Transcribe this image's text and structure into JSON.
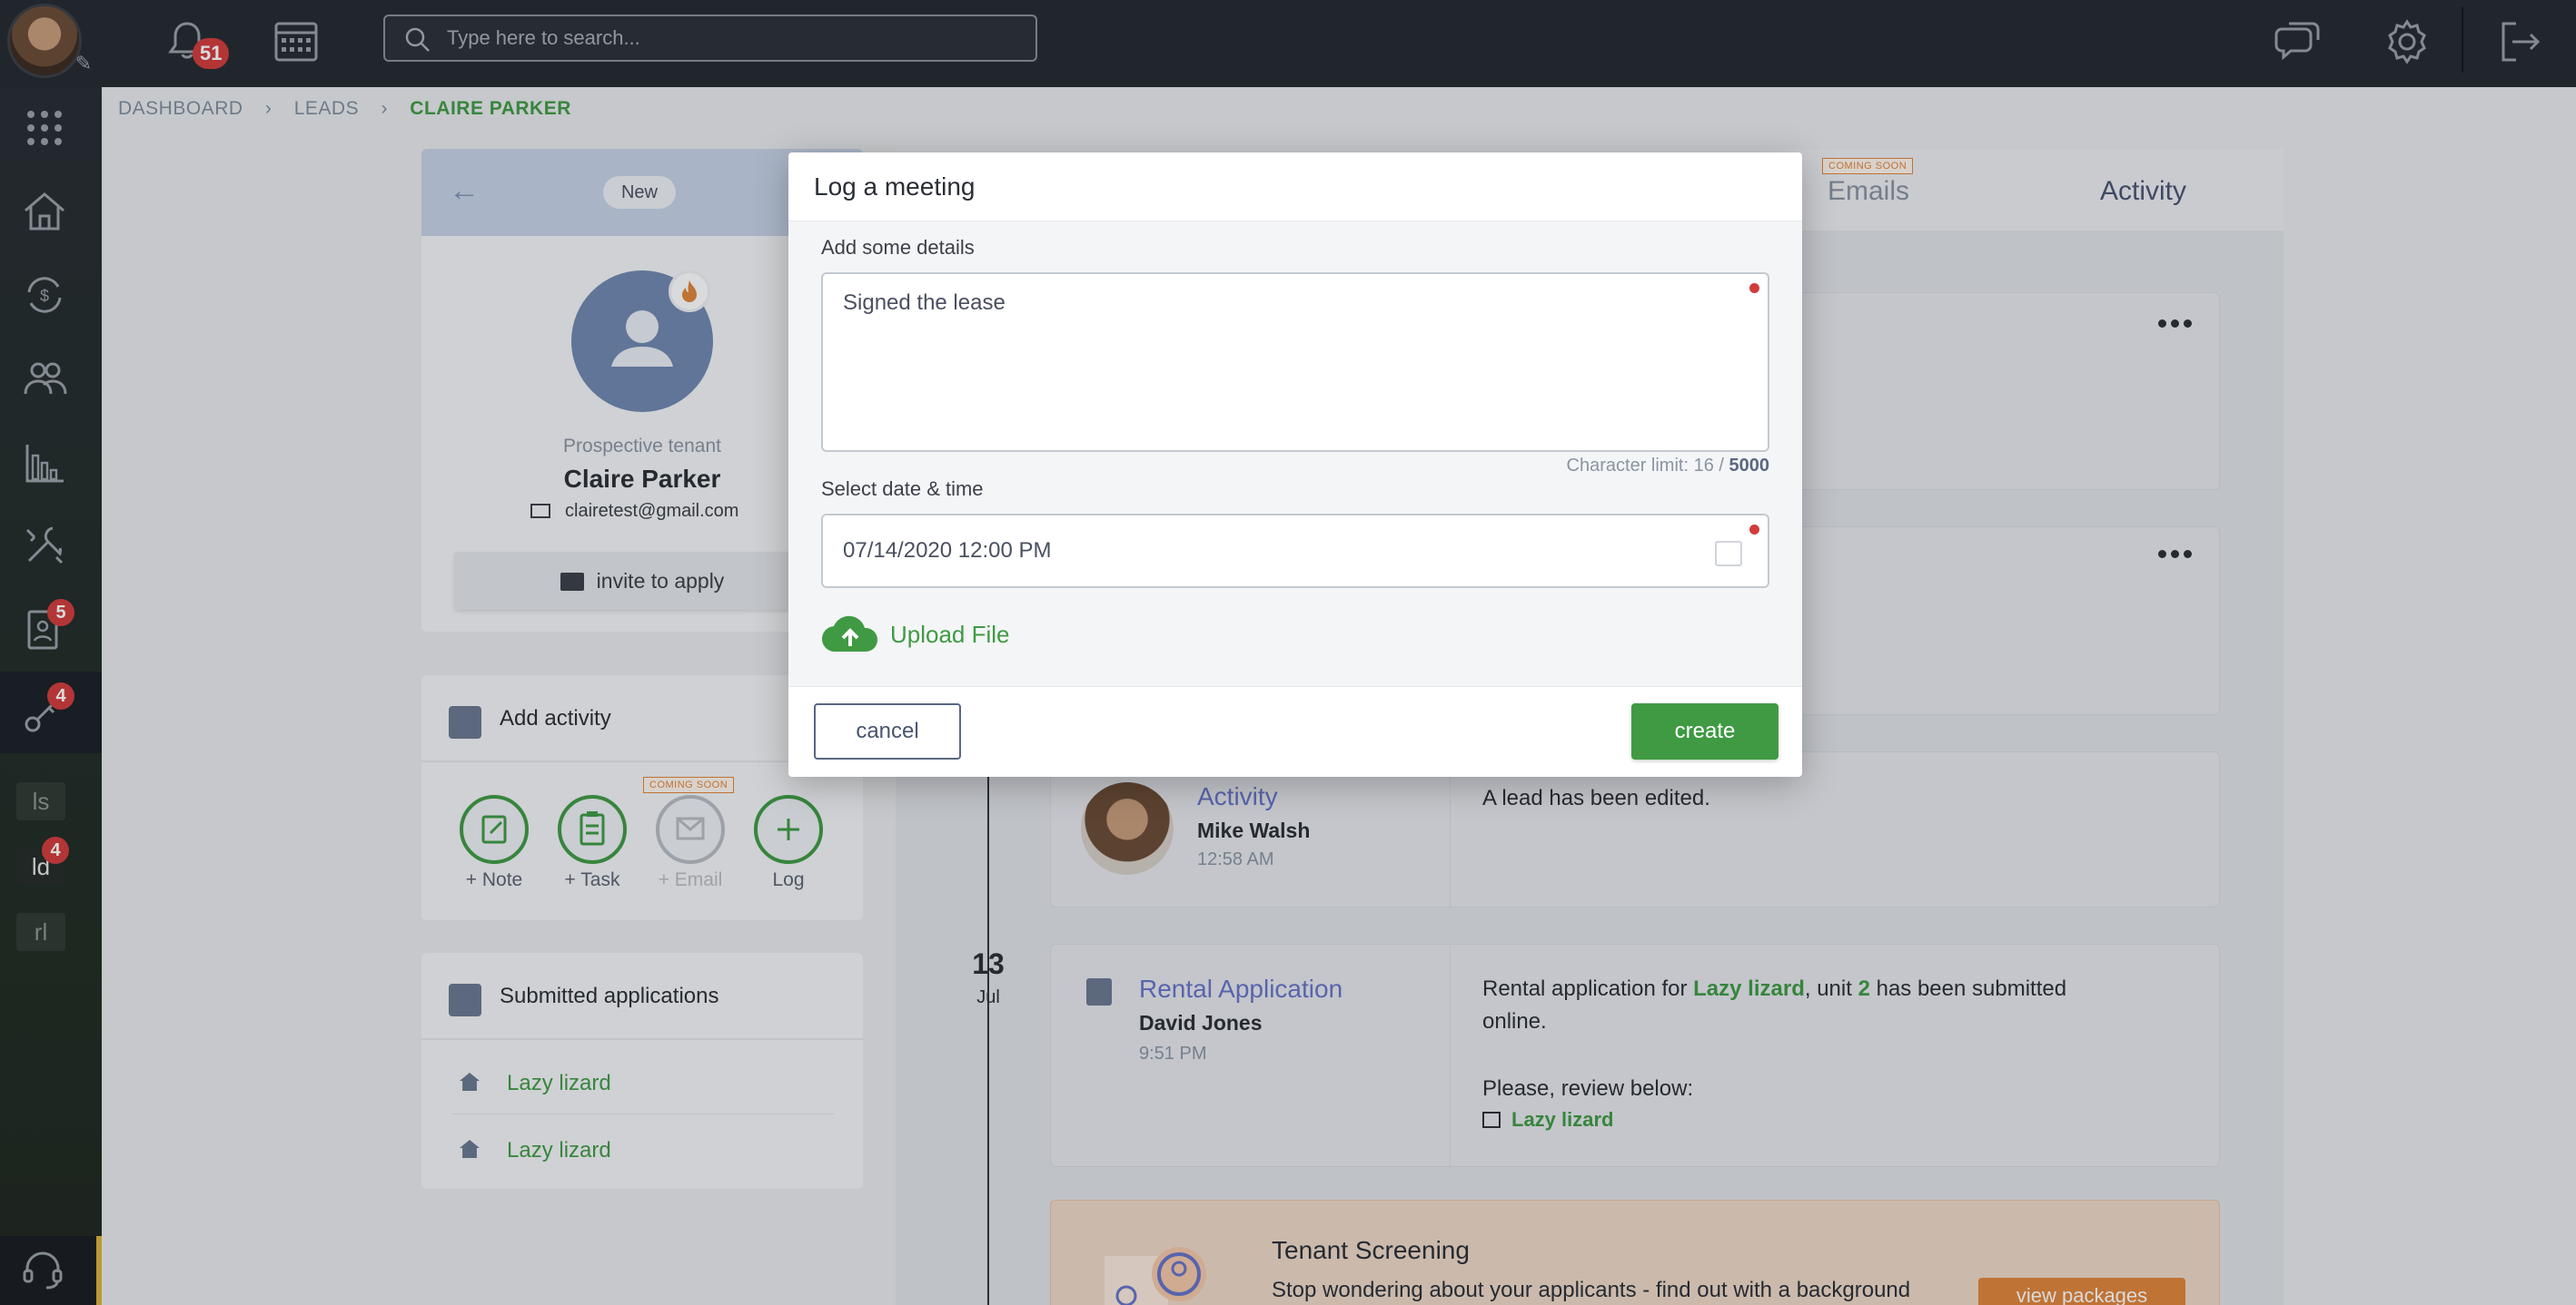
{
  "topbar": {
    "notifications_count": "51",
    "search_placeholder": "Type here to search..."
  },
  "sidebar": {
    "badges": {
      "applications": "5",
      "leads": "4"
    },
    "shortcuts": [
      {
        "label": "ls",
        "badge": ""
      },
      {
        "label": "ld",
        "badge": "4"
      },
      {
        "label": "rl",
        "badge": ""
      }
    ]
  },
  "breadcrumb": {
    "items": [
      "DASHBOARD",
      "LEADS",
      "CLAIRE PARKER"
    ]
  },
  "profile": {
    "status": "New",
    "role": "Prospective tenant",
    "name": "Claire Parker",
    "email": "clairetest@gmail.com",
    "invite_label": "invite to apply"
  },
  "add_activity": {
    "title": "Add activity",
    "coming_soon": "COMING SOON",
    "actions": [
      {
        "label": "+ Note",
        "enabled": true
      },
      {
        "label": "+ Task",
        "enabled": true
      },
      {
        "label": "+ Email",
        "enabled": false
      },
      {
        "label": "Log",
        "enabled": true
      }
    ]
  },
  "submitted_apps": {
    "title": "Submitted applications",
    "items": [
      "Lazy lizard",
      "Lazy lizard"
    ]
  },
  "tabs": {
    "emails": "Emails",
    "emails_badge": "COMING SOON",
    "activity": "Activity"
  },
  "feed": {
    "entry1": {
      "title": "Activity",
      "user": "Mike Walsh",
      "time": "12:58 AM",
      "text": "A lead has been edited."
    },
    "date": {
      "day": "13",
      "month": "Jul"
    },
    "entry2": {
      "title": "Rental Application",
      "user": "David Jones",
      "time": "9:51 PM",
      "text_before": "Rental application for ",
      "property": "Lazy lizard",
      "text_mid": ", unit ",
      "unit": "2",
      "text_after": " has been submitted online.",
      "review": "Please, review below:",
      "link": "Lazy lizard"
    },
    "screening": {
      "title": "Tenant Screening",
      "text": "Stop wondering about your applicants - find out with a background",
      "button": "view packages"
    }
  },
  "modal": {
    "title": "Log a meeting",
    "details_label": "Add some details",
    "details_value": "Signed the lease",
    "char_limit_label": "Character limit: 16 / ",
    "char_limit_max": "5000",
    "date_label": "Select date & time",
    "date_value": "07/14/2020 12:00 PM",
    "upload_label": "Upload File",
    "cancel_label": "cancel",
    "create_label": "create"
  },
  "colors": {
    "accent_green": "#3f9a43",
    "badge_red": "#d23b3b",
    "topbar": "#242930",
    "link_purple": "#6673c8"
  }
}
